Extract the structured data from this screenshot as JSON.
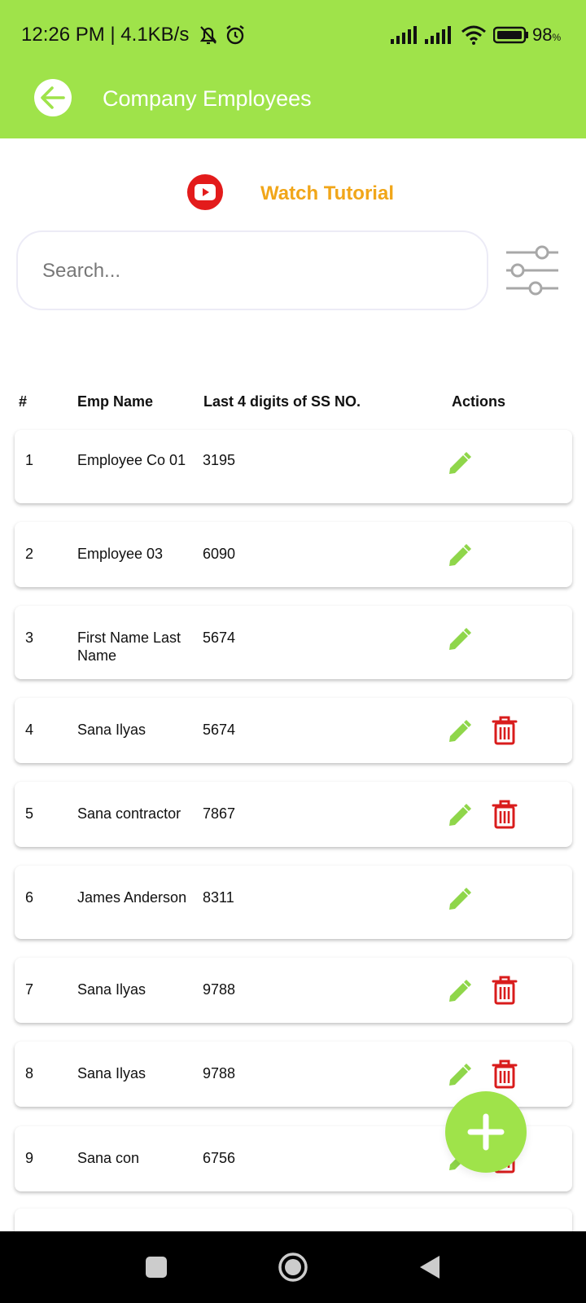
{
  "status_bar": {
    "time": "12:26 PM | 4.1KB/s",
    "battery": "98",
    "battery_unit": "%"
  },
  "header": {
    "title": "Company Employees"
  },
  "tutorial": {
    "label": "Watch Tutorial"
  },
  "search": {
    "placeholder": "Search..."
  },
  "table": {
    "columns": [
      "#",
      "Emp Name",
      "Last 4 digits of SS NO.",
      "Actions"
    ],
    "rows": [
      {
        "num": "1",
        "name": "Employee Co 01",
        "ssn": "3195",
        "can_delete": false
      },
      {
        "num": "2",
        "name": "Employee 03",
        "ssn": "6090",
        "can_delete": false
      },
      {
        "num": "3",
        "name": "First Name Last Name",
        "ssn": "5674",
        "can_delete": false
      },
      {
        "num": "4",
        "name": "Sana Ilyas",
        "ssn": "5674",
        "can_delete": true
      },
      {
        "num": "5",
        "name": "Sana contractor",
        "ssn": "7867",
        "can_delete": true
      },
      {
        "num": "6",
        "name": "James Anderson",
        "ssn": "8311",
        "can_delete": false
      },
      {
        "num": "7",
        "name": "Sana Ilyas",
        "ssn": "9788",
        "can_delete": true
      },
      {
        "num": "8",
        "name": "Sana Ilyas",
        "ssn": "9788",
        "can_delete": true
      },
      {
        "num": "9",
        "name": "Sana con",
        "ssn": "6756",
        "can_delete": true
      }
    ]
  },
  "icons": {
    "back": "arrow-left-icon",
    "tutorial": "youtube-play-icon",
    "filter": "sliders-icon",
    "edit": "pencil-icon",
    "delete": "trash-icon",
    "fab": "plus-icon"
  },
  "colors": {
    "accent": "#9fe34a",
    "tutorial_text": "#f1a619",
    "delete": "#d91c1c",
    "youtube": "#e31b1b"
  }
}
